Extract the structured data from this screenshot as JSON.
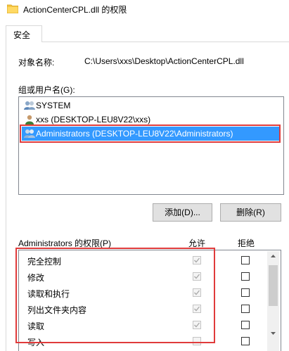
{
  "window": {
    "title": "ActionCenterCPL.dll 的权限"
  },
  "tabs": [
    {
      "label": "安全"
    }
  ],
  "object": {
    "label": "对象名称:",
    "value": "C:\\Users\\xxs\\Desktop\\ActionCenterCPL.dll"
  },
  "groups": {
    "label": "组或用户名(G):",
    "items": [
      {
        "name": "SYSTEM",
        "icon": "group-users-icon"
      },
      {
        "name": "xxs (DESKTOP-LEU8V22\\xxs)",
        "icon": "user-icon"
      },
      {
        "name": "Administrators (DESKTOP-LEU8V22\\Administrators)",
        "icon": "group-users-icon",
        "selected": true
      }
    ]
  },
  "buttons": {
    "add": "添加(D)...",
    "remove": "删除(R)"
  },
  "permissions": {
    "title": "Administrators 的权限(P)",
    "allow_header": "允许",
    "deny_header": "拒绝",
    "rows": [
      {
        "name": "完全控制",
        "allow": true,
        "deny": false
      },
      {
        "name": "修改",
        "allow": true,
        "deny": false
      },
      {
        "name": "读取和执行",
        "allow": true,
        "deny": false
      },
      {
        "name": "列出文件夹内容",
        "allow": true,
        "deny": false
      },
      {
        "name": "读取",
        "allow": true,
        "deny": false
      },
      {
        "name": "写入",
        "allow": false,
        "deny": false
      }
    ]
  },
  "colors": {
    "selection": "#3399ff",
    "highlight_box": "#e03b3b"
  }
}
